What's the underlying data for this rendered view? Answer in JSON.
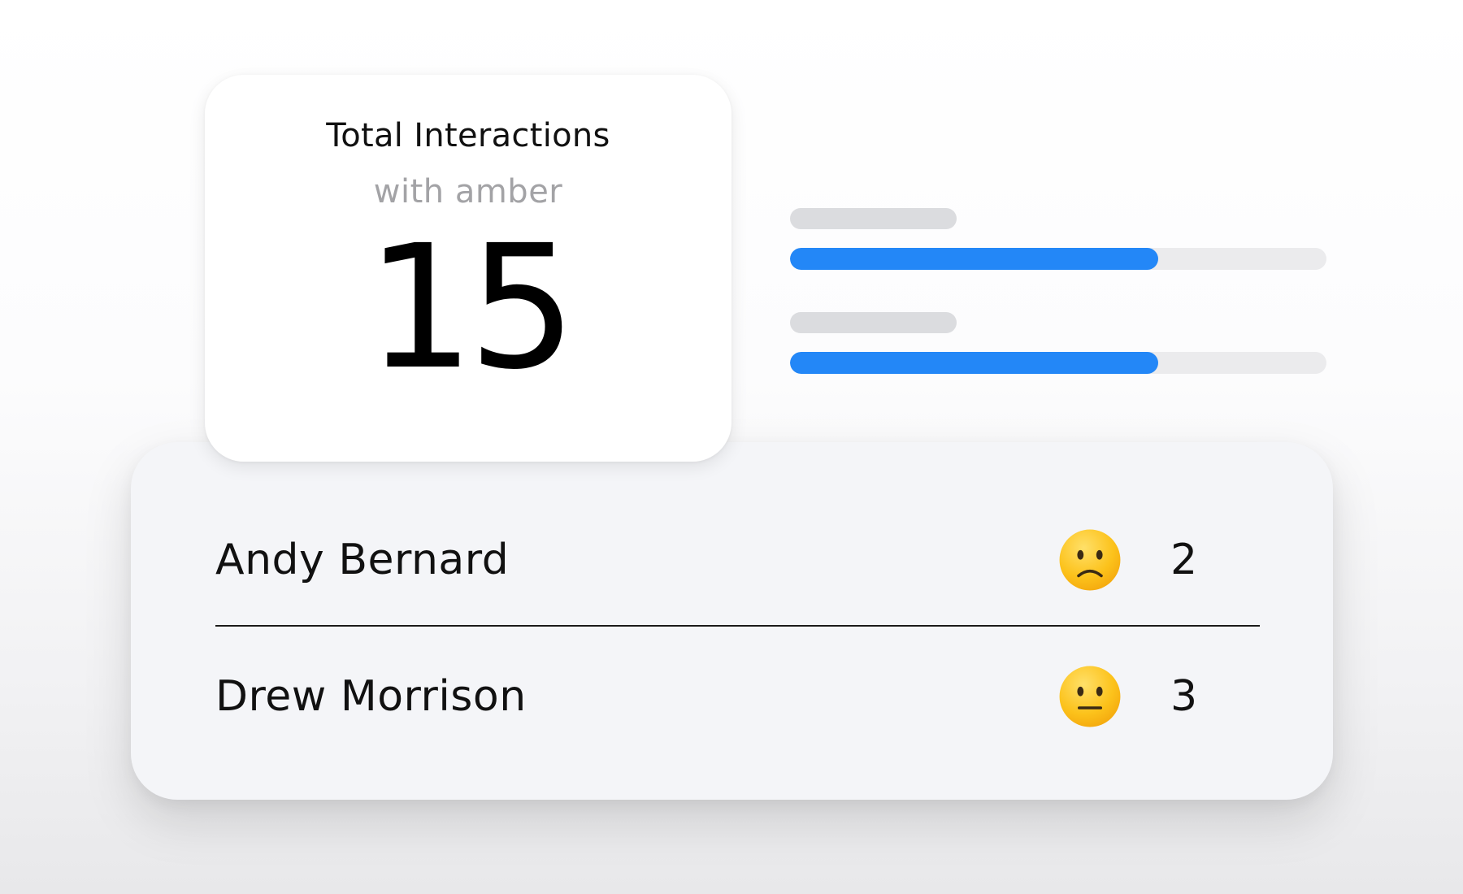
{
  "stat_card": {
    "title": "Total Interactions",
    "subtitle": "with amber",
    "value": "15"
  },
  "progress_bars": [
    {
      "fill_fraction": 0.686,
      "color": "#2387f7"
    },
    {
      "fill_fraction": 0.686,
      "color": "#2387f7"
    }
  ],
  "people": [
    {
      "name": "Andy Bernard",
      "sentiment_icon": "slightly-frowning-face-icon",
      "count": "2"
    },
    {
      "name": "Drew Morrison",
      "sentiment_icon": "neutral-face-icon",
      "count": "3"
    }
  ],
  "colors": {
    "accent": "#2387f7",
    "emoji_yellow": "#fcc21b"
  }
}
